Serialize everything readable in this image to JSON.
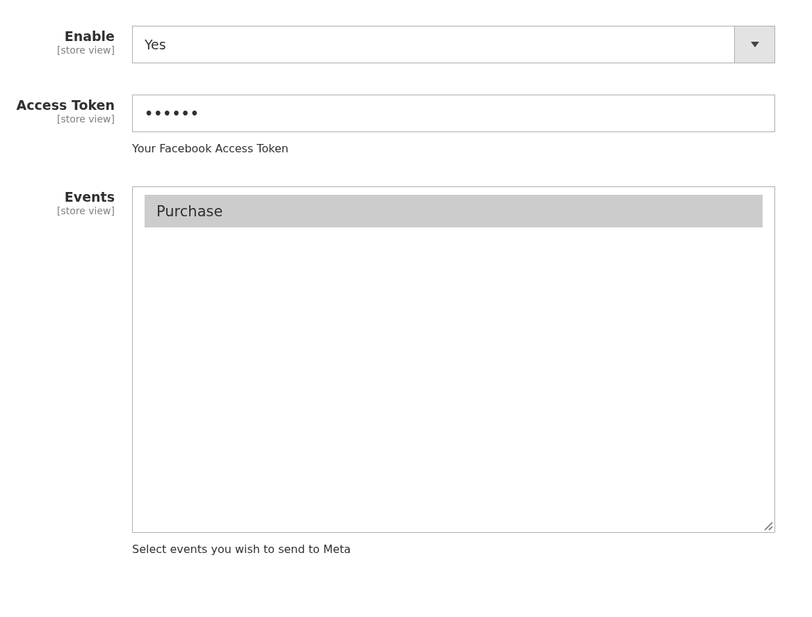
{
  "fields": [
    {
      "kind": "select",
      "label": "Enable",
      "scope": "[store view]",
      "value": "Yes"
    },
    {
      "kind": "password",
      "label": "Access Token",
      "scope": "[store view]",
      "value": "••••••",
      "note": "Your Facebook Access Token"
    },
    {
      "kind": "multiselect",
      "label": "Events",
      "scope": "[store view]",
      "options": [
        {
          "label": "Purchase",
          "selected": true
        }
      ],
      "note": "Select events you wish to send to Meta"
    }
  ]
}
